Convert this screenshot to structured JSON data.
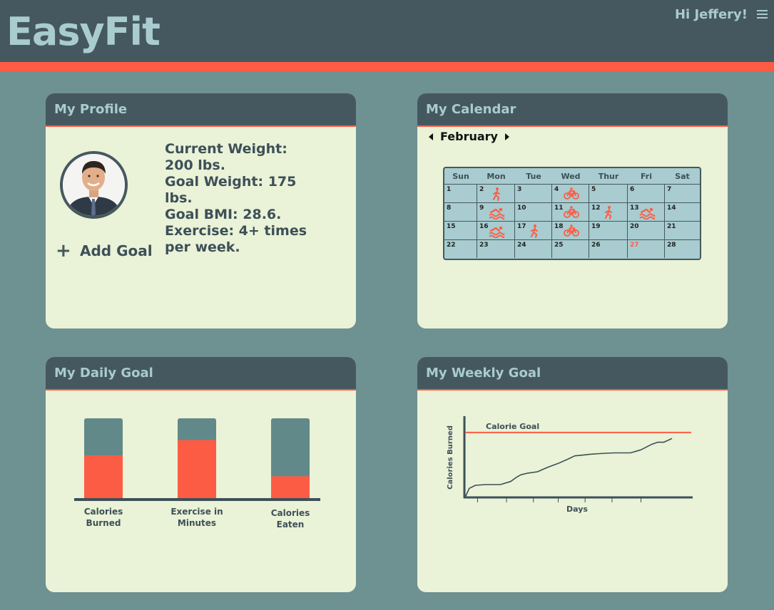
{
  "app": {
    "title": "EasyFit",
    "greeting": "Hi Jeffery!",
    "menu_icon": "hamburger-icon"
  },
  "colors": {
    "header": "#46585f",
    "accent": "#fd5c44",
    "background": "#6e9192",
    "card": "#eaf2d7",
    "light_teal": "#a8cccf",
    "text_dark": "#3d5058"
  },
  "profile": {
    "title": "My Profile",
    "stats": [
      "Current Weight: 200 lbs.",
      "Goal Weight: 175 lbs.",
      "Goal BMI: 28.6.",
      "Exercise: 4+ times per week."
    ],
    "add_goal_label": "Add Goal"
  },
  "calendar": {
    "title": "My Calendar",
    "month": "February",
    "days": [
      "Sun",
      "Mon",
      "Tue",
      "Wed",
      "Thur",
      "Fri",
      "Sat"
    ],
    "weeks": [
      [
        {
          "d": "1"
        },
        {
          "d": "2",
          "icon": "run"
        },
        {
          "d": "3"
        },
        {
          "d": "4",
          "icon": "bike"
        },
        {
          "d": "5"
        },
        {
          "d": "6"
        },
        {
          "d": "7"
        }
      ],
      [
        {
          "d": "8"
        },
        {
          "d": "9",
          "icon": "swim"
        },
        {
          "d": "10"
        },
        {
          "d": "11",
          "icon": "bike"
        },
        {
          "d": "12",
          "icon": "run"
        },
        {
          "d": "13",
          "icon": "swim"
        },
        {
          "d": "14"
        }
      ],
      [
        {
          "d": "15"
        },
        {
          "d": "16",
          "icon": "swim"
        },
        {
          "d": "17",
          "icon": "run"
        },
        {
          "d": "18",
          "icon": "bike"
        },
        {
          "d": "19"
        },
        {
          "d": "20"
        },
        {
          "d": "21"
        }
      ],
      [
        {
          "d": "22"
        },
        {
          "d": "23"
        },
        {
          "d": "24"
        },
        {
          "d": "25"
        },
        {
          "d": "26"
        },
        {
          "d": "27",
          "highlight": true
        },
        {
          "d": "28"
        }
      ]
    ]
  },
  "daily_goal": {
    "title": "My Daily Goal",
    "chart_data": {
      "type": "bar",
      "categories": [
        "Calories Burned",
        "Exercise in Minutes",
        "Calories Eaten"
      ],
      "values": [
        0.54,
        0.73,
        0.28
      ],
      "ylim": [
        0,
        1
      ],
      "colors": {
        "progress": "#fd5c44",
        "remaining": "#628989"
      }
    }
  },
  "weekly_goal": {
    "title": "My Weekly Goal",
    "chart_data": {
      "type": "line",
      "xlabel": "Days",
      "ylabel": "Calories Burned",
      "ylim": [
        0,
        100
      ],
      "goal_line": {
        "label": "Calorie Goal",
        "value": 86,
        "color": "#fd5c44"
      },
      "x": [
        0,
        2,
        5,
        10,
        17,
        22,
        25,
        27,
        30,
        35,
        40,
        45,
        50,
        53,
        57,
        60,
        65,
        72,
        80,
        85,
        90,
        93,
        96,
        100
      ],
      "y": [
        0,
        12,
        16,
        17,
        17,
        21,
        27,
        30,
        32,
        34,
        40,
        45,
        51,
        55,
        56,
        57,
        58,
        59,
        59,
        63,
        70,
        73,
        73,
        78
      ],
      "xlim": [
        0,
        100
      ],
      "x_ticks": [
        6,
        20,
        33,
        45,
        58,
        71,
        85
      ],
      "color": "#3d5058"
    }
  }
}
